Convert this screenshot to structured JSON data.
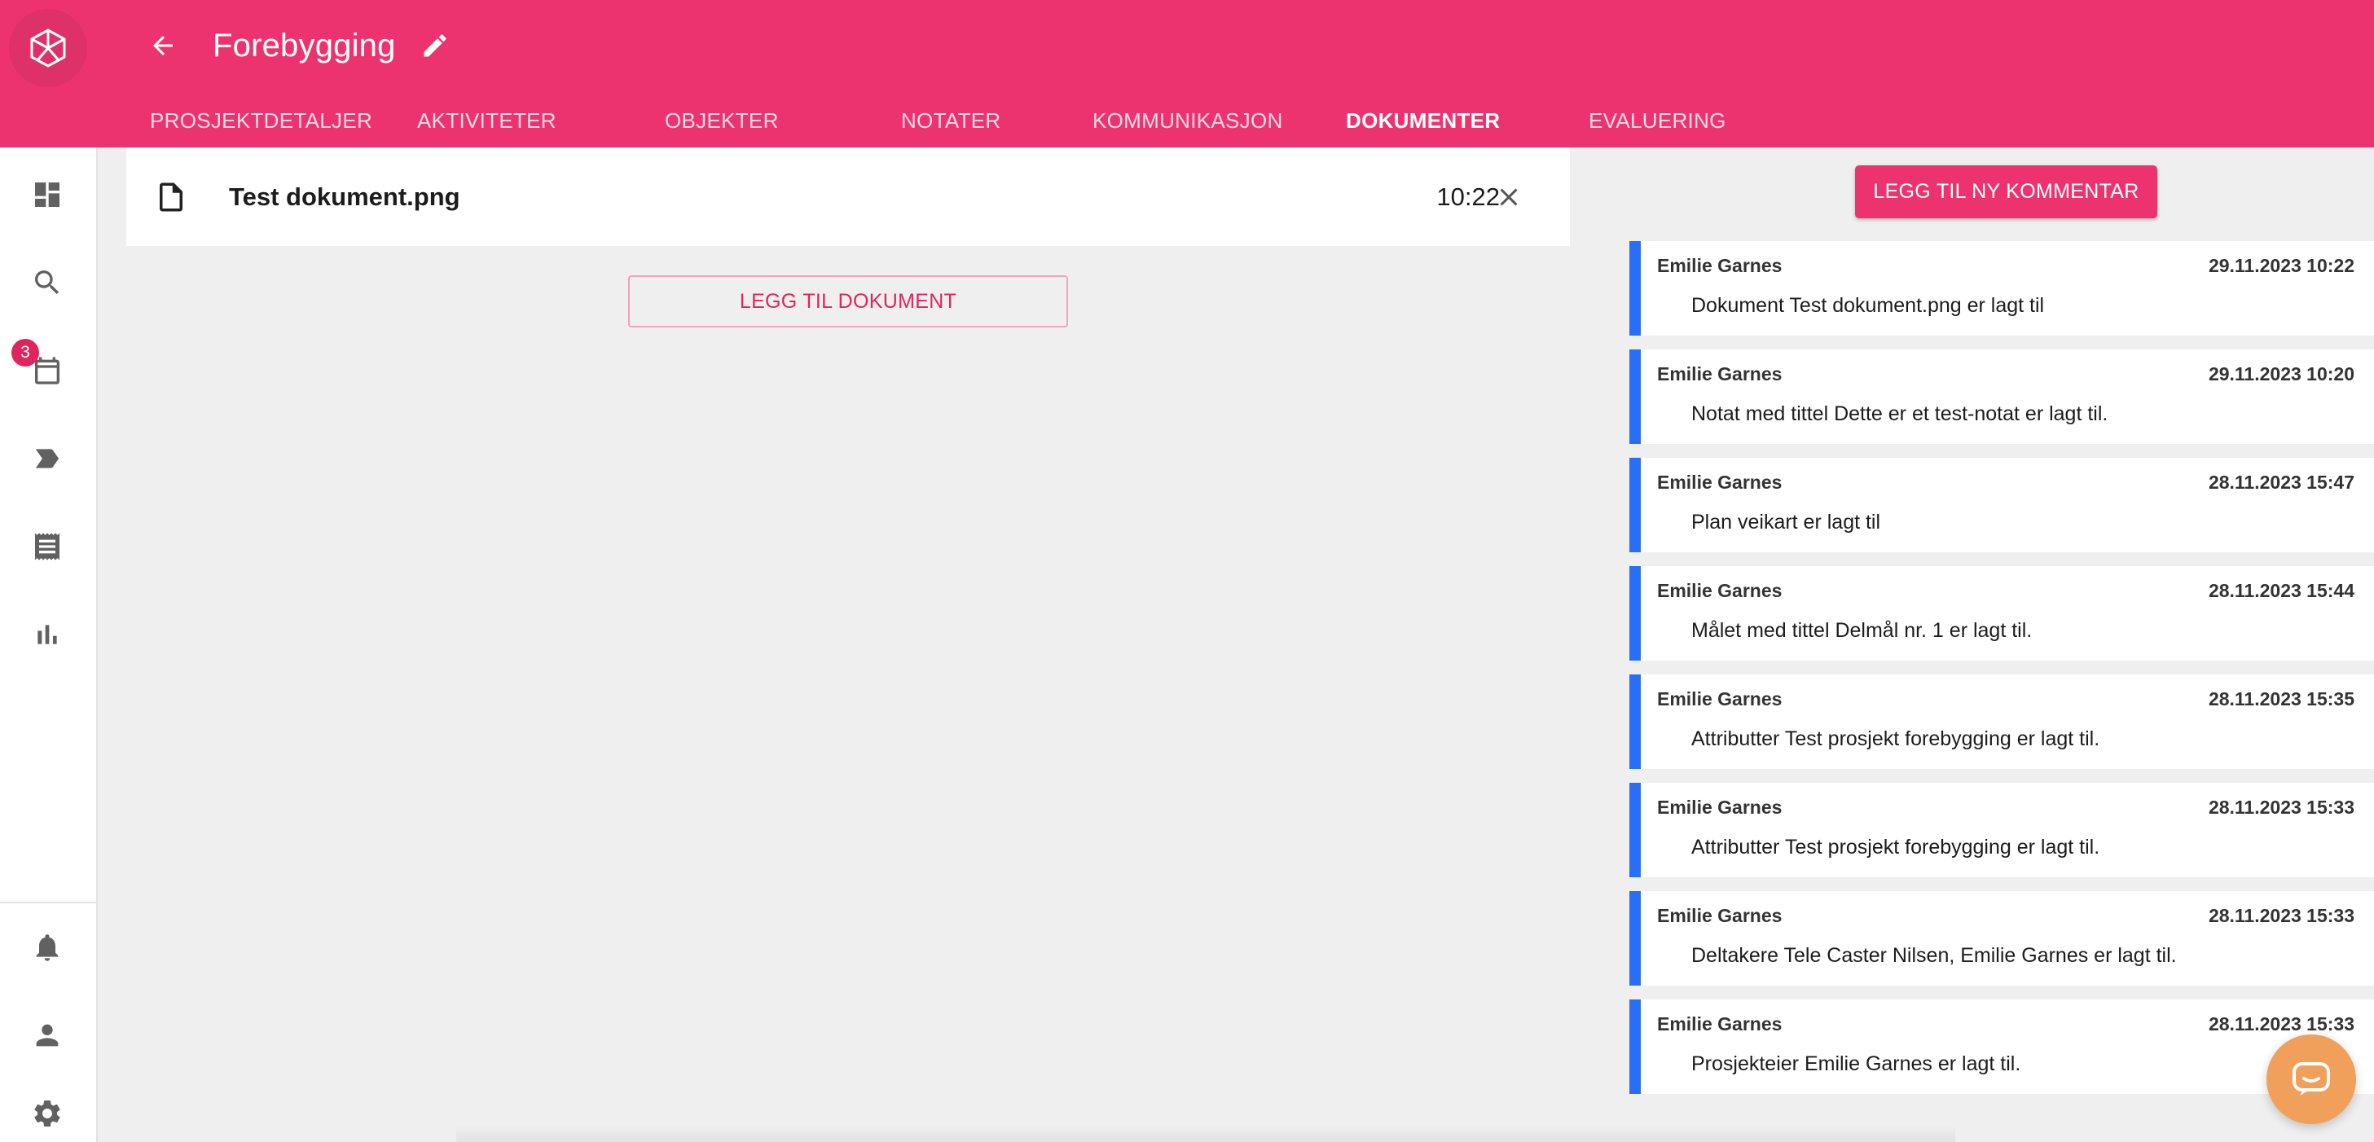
{
  "header": {
    "title": "Forebygging",
    "tabs": [
      {
        "label": "PROSJEKTDETALJER",
        "active": false
      },
      {
        "label": "AKTIVITETER",
        "active": false
      },
      {
        "label": "OBJEKTER",
        "active": false
      },
      {
        "label": "NOTATER",
        "active": false
      },
      {
        "label": "KOMMUNIKASJON",
        "active": false
      },
      {
        "label": "DOKUMENTER",
        "active": true
      },
      {
        "label": "EVALUERING",
        "active": false
      }
    ]
  },
  "sidebar": {
    "items": [
      {
        "icon": "dashboard-icon"
      },
      {
        "icon": "search-icon"
      },
      {
        "icon": "calendar-icon",
        "badge": "3"
      },
      {
        "icon": "label-icon"
      },
      {
        "icon": "receipt-icon"
      },
      {
        "icon": "bar-chart-icon"
      }
    ],
    "bottom_items": [
      {
        "icon": "bell-icon"
      },
      {
        "icon": "person-icon"
      },
      {
        "icon": "gear-icon"
      }
    ]
  },
  "documents": {
    "items": [
      {
        "name": "Test dokument.png",
        "time": "10:22"
      }
    ],
    "add_label": "LEGG TIL DOKUMENT"
  },
  "comments": {
    "add_label": "LEGG TIL NY KOMMENTAR",
    "items": [
      {
        "author": "Emilie Garnes",
        "time": "29.11.2023 10:22",
        "text": "Dokument Test dokument.png er lagt til"
      },
      {
        "author": "Emilie Garnes",
        "time": "29.11.2023 10:20",
        "text": "Notat med tittel Dette er et test-notat er lagt til."
      },
      {
        "author": "Emilie Garnes",
        "time": "28.11.2023 15:47",
        "text": "Plan veikart er lagt til"
      },
      {
        "author": "Emilie Garnes",
        "time": "28.11.2023 15:44",
        "text": "Målet med tittel Delmål nr. 1 er lagt til."
      },
      {
        "author": "Emilie Garnes",
        "time": "28.11.2023 15:35",
        "text": "Attributter Test prosjekt forebygging er lagt til."
      },
      {
        "author": "Emilie Garnes",
        "time": "28.11.2023 15:33",
        "text": "Attributter Test prosjekt forebygging er lagt til."
      },
      {
        "author": "Emilie Garnes",
        "time": "28.11.2023 15:33",
        "text": "Deltakere Tele Caster Nilsen, Emilie Garnes er lagt til."
      },
      {
        "author": "Emilie Garnes",
        "time": "28.11.2023 15:33",
        "text": "Prosjekteier Emilie Garnes er lagt til."
      }
    ]
  },
  "colors": {
    "brand": "#ec3370",
    "accent_bar": "#2a6ef5",
    "badge": "#e0245e",
    "chat": "#f0a05a"
  }
}
